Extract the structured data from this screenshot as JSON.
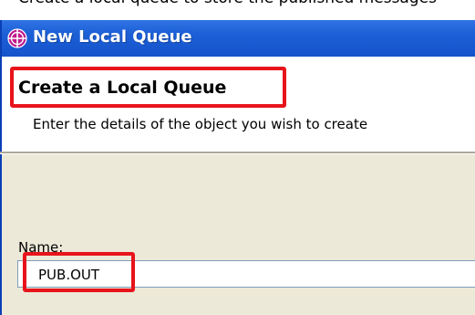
{
  "top_caption": "Create a local queue to store the published messages",
  "window": {
    "title": "New Local Queue",
    "icon": "queue-app-icon"
  },
  "header": {
    "title": "Create a Local Queue",
    "description": "Enter the details of the object you wish to create"
  },
  "form": {
    "name_label": "Name:",
    "name_value": "PUB.OUT"
  },
  "highlights": {
    "color": "#e8141b",
    "targets": [
      "header-title",
      "name-input"
    ]
  },
  "colors": {
    "titlebar": "#1c5fd6",
    "panel_bg": "#ece9d8",
    "input_border": "#7f9db9"
  }
}
